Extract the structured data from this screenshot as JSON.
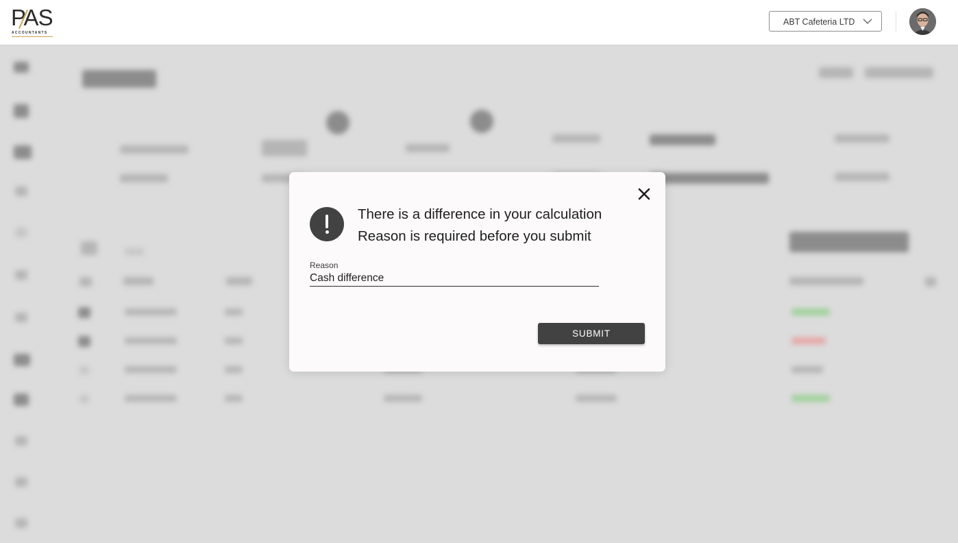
{
  "header": {
    "logo_text": "PAS",
    "logo_subtext": "ACCOUNTANTS",
    "company_select_value": "ABT Cafeteria LTD"
  },
  "dialog": {
    "message_line1": "There is a difference in your calculation",
    "message_line2": "Reason is required before you submit",
    "reason_label": "Reason",
    "reason_value": "Cash difference",
    "submit_label": "SUBMIT"
  },
  "icons": {
    "close": "close-icon",
    "alert": "exclamation-icon",
    "dropdown": "chevron-down-icon",
    "avatar": "user-avatar"
  },
  "colors": {
    "dialog_bg": "#fcfafa",
    "button_bg": "#424242",
    "overlay_bg": "#dcdcdc",
    "logo_accent": "#c9a64b"
  }
}
